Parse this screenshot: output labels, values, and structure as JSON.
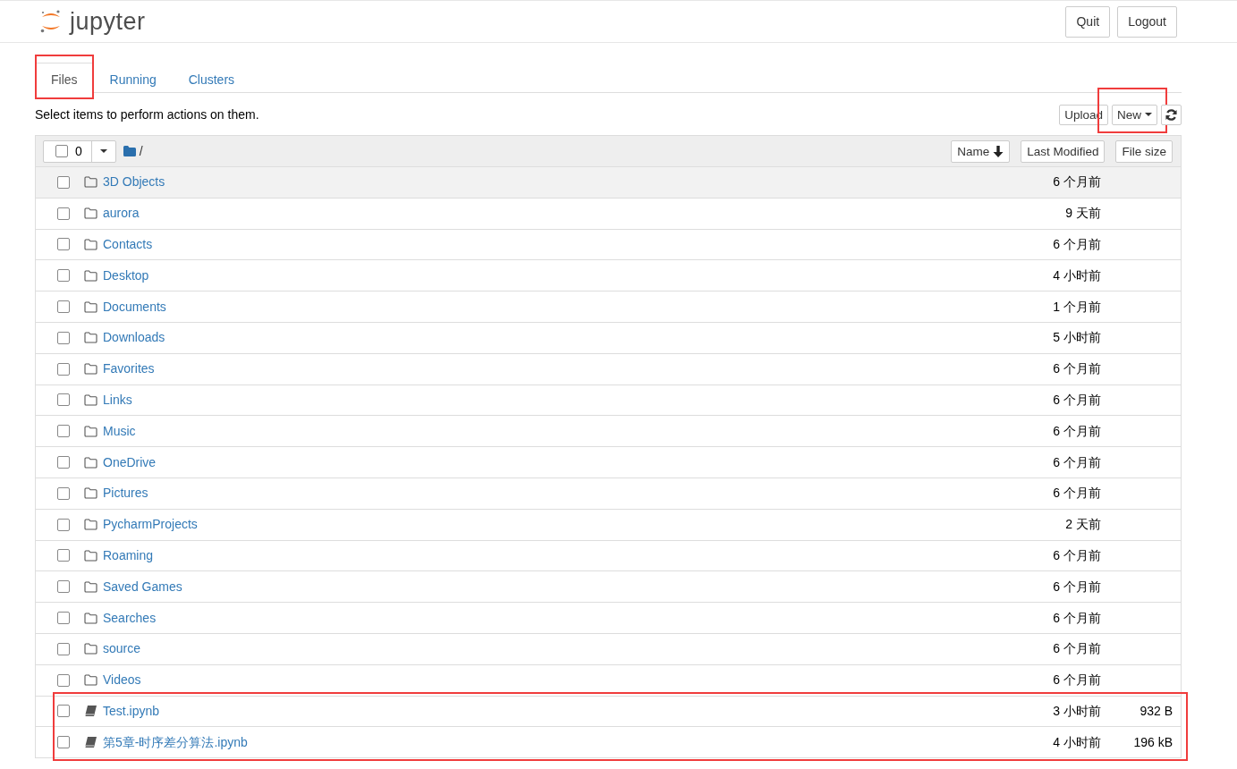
{
  "header": {
    "logo_text": "jupyter",
    "buttons": [
      {
        "label": "Quit"
      },
      {
        "label": "Logout"
      }
    ]
  },
  "tabs": [
    {
      "label": "Files",
      "selected": true,
      "highlighted": true
    },
    {
      "label": "Running",
      "selected": false,
      "highlighted": false
    },
    {
      "label": "Clusters",
      "selected": false,
      "highlighted": false
    }
  ],
  "instructions": "Select items to perform actions on them.",
  "actions": [
    {
      "kind": "button",
      "label": "Upload",
      "highlighted": false
    },
    {
      "kind": "dropdown",
      "label": "New",
      "highlighted": true
    },
    {
      "kind": "refresh",
      "highlighted": false
    }
  ],
  "list_header": {
    "select_all_checked": false,
    "selected_count": "0",
    "path": "/",
    "sort_buttons": [
      {
        "label": "Name",
        "sorted": true
      },
      {
        "label": "Last Modified",
        "sorted": false
      },
      {
        "label": "File size",
        "sorted": false
      }
    ]
  },
  "rows": [
    {
      "kind": "folder",
      "name": "3D Objects",
      "modified": "6 个月前",
      "checked": false,
      "hovered": true,
      "highlighted": false
    },
    {
      "kind": "folder",
      "name": "aurora",
      "modified": "9 天前",
      "checked": false,
      "hovered": false,
      "highlighted": false
    },
    {
      "kind": "folder",
      "name": "Contacts",
      "modified": "6 个月前",
      "checked": false,
      "hovered": false,
      "highlighted": false
    },
    {
      "kind": "folder",
      "name": "Desktop",
      "modified": "4 小时前",
      "checked": false,
      "hovered": false,
      "highlighted": false
    },
    {
      "kind": "folder",
      "name": "Documents",
      "modified": "1 个月前",
      "checked": false,
      "hovered": false,
      "highlighted": false
    },
    {
      "kind": "folder",
      "name": "Downloads",
      "modified": "5 小时前",
      "checked": false,
      "hovered": false,
      "highlighted": false
    },
    {
      "kind": "folder",
      "name": "Favorites",
      "modified": "6 个月前",
      "checked": false,
      "hovered": false,
      "highlighted": false
    },
    {
      "kind": "folder",
      "name": "Links",
      "modified": "6 个月前",
      "checked": false,
      "hovered": false,
      "highlighted": false
    },
    {
      "kind": "folder",
      "name": "Music",
      "modified": "6 个月前",
      "checked": false,
      "hovered": false,
      "highlighted": false
    },
    {
      "kind": "folder",
      "name": "OneDrive",
      "modified": "6 个月前",
      "checked": false,
      "hovered": false,
      "highlighted": false
    },
    {
      "kind": "folder",
      "name": "Pictures",
      "modified": "6 个月前",
      "checked": false,
      "hovered": false,
      "highlighted": false
    },
    {
      "kind": "folder",
      "name": "PycharmProjects",
      "modified": "2 天前",
      "checked": false,
      "hovered": false,
      "highlighted": false
    },
    {
      "kind": "folder",
      "name": "Roaming",
      "modified": "6 个月前",
      "checked": false,
      "hovered": false,
      "highlighted": false
    },
    {
      "kind": "folder",
      "name": "Saved Games",
      "modified": "6 个月前",
      "checked": false,
      "hovered": false,
      "highlighted": false
    },
    {
      "kind": "folder",
      "name": "Searches",
      "modified": "6 个月前",
      "checked": false,
      "hovered": false,
      "highlighted": false
    },
    {
      "kind": "folder",
      "name": "source",
      "modified": "6 个月前",
      "checked": false,
      "hovered": false,
      "highlighted": false
    },
    {
      "kind": "folder",
      "name": "Videos",
      "modified": "6 个月前",
      "checked": false,
      "hovered": false,
      "highlighted": false
    },
    {
      "kind": "notebook",
      "name": "Test.ipynb",
      "modified": "3 小时前",
      "size": "932 B",
      "checked": false,
      "hovered": false,
      "highlighted": true
    },
    {
      "kind": "notebook",
      "name": "第5章-时序差分算法.ipynb",
      "modified": "4 小时前",
      "size": "196 kB",
      "checked": false,
      "hovered": false,
      "highlighted": true
    }
  ]
}
